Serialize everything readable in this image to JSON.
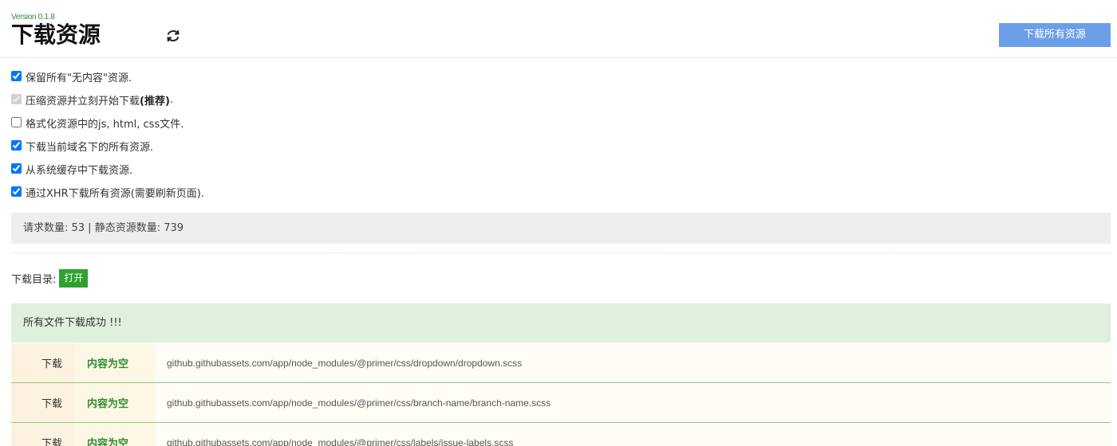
{
  "header": {
    "version": "Version 0.1.8",
    "title": "下载资源",
    "download_all_label": "下载所有资源"
  },
  "options": [
    {
      "label": "保留所有\"无内容\"资源.",
      "bold": "",
      "suffix": "",
      "checked": true,
      "disabled": false
    },
    {
      "label": "压缩资源并立刻开始下载",
      "bold": "(推荐)",
      "suffix": ".",
      "checked": true,
      "disabled": true
    },
    {
      "label": "格式化资源中的js, html, css文件.",
      "bold": "",
      "suffix": "",
      "checked": false,
      "disabled": false
    },
    {
      "label": "下载当前域名下的所有资源.",
      "bold": "",
      "suffix": "",
      "checked": true,
      "disabled": false
    },
    {
      "label": "从系统缓存中下载资源.",
      "bold": "",
      "suffix": "",
      "checked": true,
      "disabled": false
    },
    {
      "label": "通过XHR下载所有资源(需要刷新页面).",
      "bold": "",
      "suffix": "",
      "checked": true,
      "disabled": false
    }
  ],
  "stats": {
    "text": "请求数量: 53 | 静态资源数量: 739"
  },
  "directory": {
    "label": "下载目录:",
    "open_label": "打开"
  },
  "success_message": "所有文件下载成功 !!!",
  "files": [
    {
      "action": "下载",
      "status": "内容为空",
      "url": "github.githubassets.com/app/node_modules/@primer/css/dropdown/dropdown.scss"
    },
    {
      "action": "下载",
      "status": "内容为空",
      "url": "github.githubassets.com/app/node_modules/@primer/css/branch-name/branch-name.scss"
    },
    {
      "action": "下载",
      "status": "内容为空",
      "url": "github.githubassets.com/app/node_modules/@primer/css/labels/issue-labels.scss"
    }
  ],
  "colors": {
    "accent_blue": "#6c9fe8",
    "success_green": "#2ea12e",
    "success_bg": "#dff0dc"
  }
}
